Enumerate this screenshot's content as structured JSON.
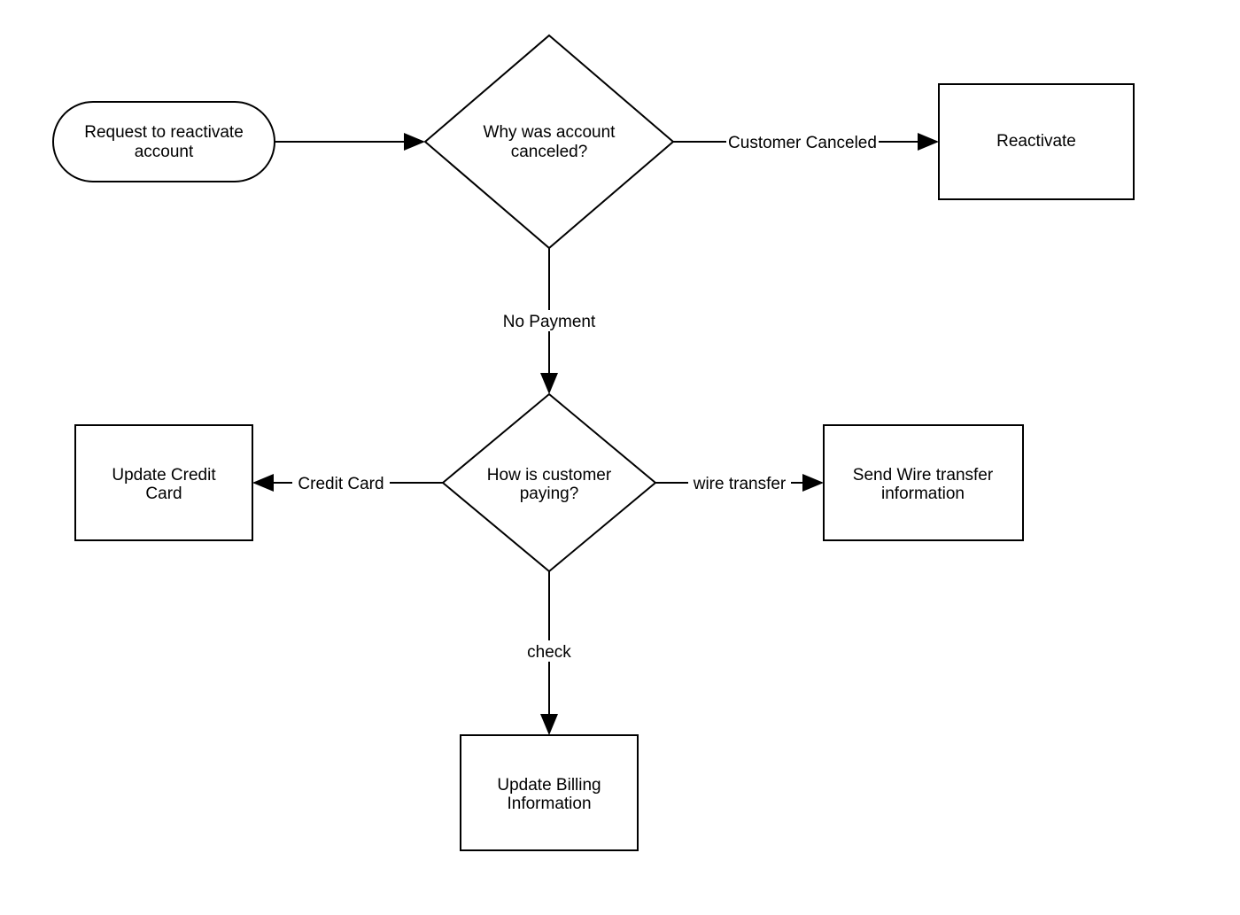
{
  "nodes": {
    "start": {
      "line1": "Request to reactivate",
      "line2": "account"
    },
    "decision1": {
      "line1": "Why was account",
      "line2": "canceled?"
    },
    "reactivate": {
      "line1": "Reactivate"
    },
    "decision2": {
      "line1": "How is customer",
      "line2": "paying?"
    },
    "updateCard": {
      "line1": "Update Credit",
      "line2": "Card"
    },
    "sendWire": {
      "line1": "Send Wire transfer",
      "line2": "information"
    },
    "updateBilling": {
      "line1": "Update Billing",
      "line2": "Information"
    }
  },
  "edges": {
    "customerCanceled": "Customer Canceled",
    "noPayment": "No Payment",
    "creditCard": "Credit Card",
    "wireTransfer": "wire transfer",
    "check": "check"
  }
}
